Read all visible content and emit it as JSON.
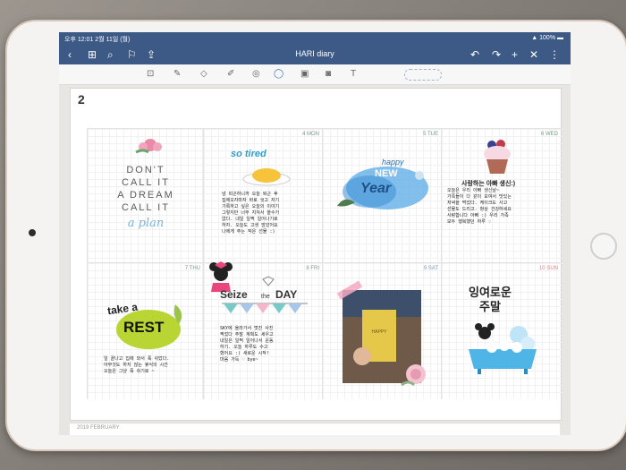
{
  "status": {
    "time": "오후 12:01",
    "date": "2월 11일 (월)",
    "battery": "100%"
  },
  "app": {
    "title": "HARI diary"
  },
  "page": {
    "month_number": "2",
    "footer": "2019 FEBRUARY"
  },
  "days": [
    {
      "num": "4",
      "name": "MON"
    },
    {
      "num": "5",
      "name": "TUE"
    },
    {
      "num": "6",
      "name": "WED"
    },
    {
      "num": "7",
      "name": "THU"
    },
    {
      "num": "8",
      "name": "FRI"
    },
    {
      "num": "9",
      "name": "SAT"
    },
    {
      "num": "10",
      "name": "SUN"
    }
  ],
  "quote": {
    "line1": "DON'T",
    "line2": "CALL IT",
    "line3": "A DREAM",
    "line4": "CALL IT",
    "line5": "a plan"
  },
  "stickers": {
    "so_tired": "so tired",
    "happy_new_year_1": "happy",
    "happy_new_year_2": "NEW",
    "happy_new_year_3": "Year",
    "wed_title": "사랑하는 아빠 생신:)",
    "take_a_rest_1": "take a",
    "take_a_rest_2": "REST",
    "seize_1": "Seize",
    "seize_2": "the",
    "seize_3": "DAY",
    "book": "HAPPY",
    "sun_title_1": "잉여로운",
    "sun_title_2": "주말"
  },
  "notes": {
    "mon": "넘 피곤하니까 오늘 퇴근 후\n집에오자마자 바로 씻고 자기\n기록하고 싶은 오늘의 이야기\n그렇지만 너무 지쳐서 쓸수가\n없다. 내일 일찍 일어나기로\n하자. 오늘도 고생 많았어요\n나에게 주는 작은 선물 :)",
    "wed": "오늘은 우리 아빠 생신날~\n가족들이 다 같이 모여서 맛있는\n저녁을 먹었다. 케이크도 사고\n선물도 드리고. 항상 건강하세요\n사랑합니다 아빠 :) 우리 가족\n모두 행복했던 하루 ♡",
    "thu": "일 끝나고 집에 와서 푹 쉬었다.\n아무것도 하지 않는 휴식의 시간\n오늘은 그냥 푹 쉬기로 ~",
    "fri": "SKY에 올라가서 멋진 사진\n찍었다 주말 계획도 세우고\n내일은 일찍 일어나서 운동\n하기. 오늘 하루도 수고\n했어요 :) 새로운 시작!\n마음 가득 ♡ bye~"
  },
  "colors": {
    "nav": "#3c5a85",
    "accent_blue": "#7db3d6"
  }
}
